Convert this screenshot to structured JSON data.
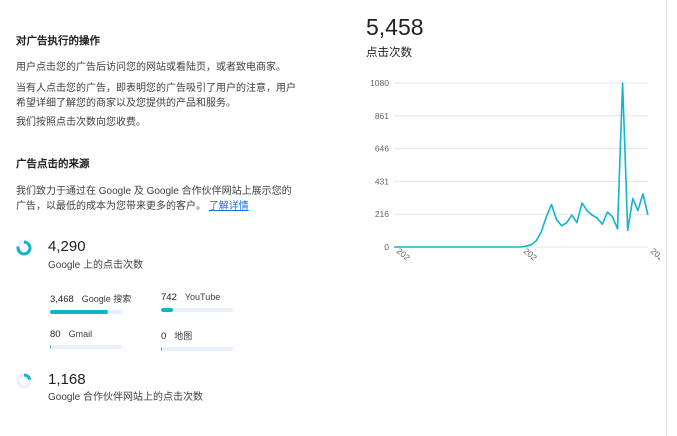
{
  "section1": {
    "title": "对广告执行的操作",
    "p1": "用户点击您的广告后访问您的网站或看陆页，或者致电商家。",
    "p2_line1": "当有人点击您的广告，即表明您的广告吸引了用户的注意，用户",
    "p2_line2": "希望详细了解您的商家以及您提供的产品和服务。",
    "p3": "我们按照点击次数向您收费。"
  },
  "section2": {
    "title": "广告点击的来源",
    "p1_line1": "我们致力于通过在 Google 及 Google 合作伙伴网站上展示您的",
    "p1_line2": "广告，以最低的成本为您带来更多的客户。",
    "link": "了解详情"
  },
  "google_clicks": {
    "value": "4,290",
    "label": "Google 上的点击次数",
    "fraction": 0.786
  },
  "breakdown": [
    {
      "value": "3,468",
      "label": "Google 搜索",
      "fraction": 0.81
    },
    {
      "value": "742",
      "label": "YouTube",
      "fraction": 0.173
    },
    {
      "value": "80",
      "label": "Gmail",
      "fraction": 0.019
    },
    {
      "value": "0",
      "label": "地图",
      "fraction": 0.0
    }
  ],
  "partner_clicks": {
    "value": "1,168",
    "label": "Google 合作伙伴网站上的点击次数",
    "fraction": 0.214
  },
  "total": {
    "value": "5,458",
    "label": "点击次数"
  },
  "colors": {
    "accent": "#12b5cb",
    "track": "#e8f0fe",
    "link": "#1a73e8"
  },
  "chart_data": {
    "type": "line",
    "y_ticks": [
      "1080",
      "861",
      "646",
      "431",
      "216",
      "0"
    ],
    "ylim": [
      0,
      1080
    ],
    "x_tick_labels": [
      "202",
      "202",
      "202"
    ],
    "grid": true,
    "series": [
      {
        "values": [
          0,
          0,
          0,
          0,
          0,
          0,
          0,
          0,
          0,
          0,
          0,
          0,
          0,
          0,
          0,
          0,
          0,
          0,
          0,
          0,
          0,
          0,
          0,
          0,
          0,
          0,
          5,
          15,
          40,
          100,
          200,
          280,
          180,
          140,
          160,
          210,
          160,
          290,
          240,
          210,
          190,
          150,
          230,
          200,
          120,
          1080,
          110,
          320,
          240,
          350,
          210
        ]
      }
    ]
  }
}
